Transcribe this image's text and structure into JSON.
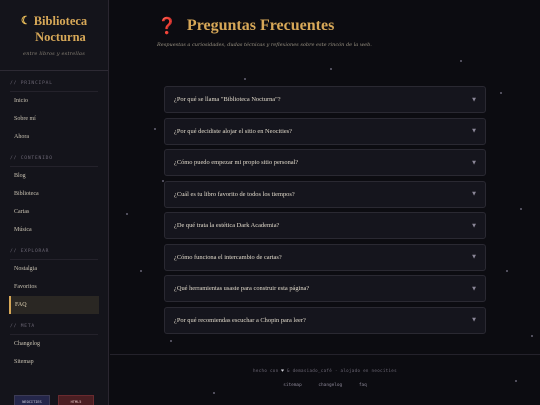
{
  "sidebar": {
    "brand_title_line1": "Biblioteca",
    "brand_title_line2": "Nocturna",
    "brand_icon": "crescent-moon-icon",
    "brand_subtitle": "entre libros y estrellas",
    "sections": [
      {
        "label": "// PRINCIPAL",
        "items": [
          "Inicio",
          "Sobre mí",
          "Ahora"
        ]
      },
      {
        "label": "// CONTENIDO",
        "items": [
          "Blog",
          "Biblioteca",
          "Cartas",
          "Música"
        ]
      },
      {
        "label": "// EXPLORAR",
        "items": [
          "Nostalgia",
          "Favoritos",
          "FAQ"
        ]
      },
      {
        "label": "// META",
        "items": [
          "Changelog",
          "Sitemap"
        ]
      }
    ],
    "active_item": "FAQ",
    "badges": [
      "NEOCITIES",
      "HTML5"
    ]
  },
  "main": {
    "title_icon": "question-mark-icon",
    "title": "Preguntas Frecuentes",
    "subtitle": "Respuestas a curiosidades, dudas técnicas y reflexiones sobre este rincón de la web.",
    "faq": [
      "¿Por qué se llama \"Biblioteca Nocturna\"?",
      "¿Por qué decidiste alojar el sitio en Neocities?",
      "¿Cómo puedo empezar mi propio sitio personal?",
      "¿Cuál es tu libro favorito de todos los tiempos?",
      "¿De qué trata la estética Dark Academia?",
      "¿Cómo funciona el intercambio de cartas?",
      "¿Qué herramientas usaste para construir esta página?",
      "¿Por qué recomiendas escuchar a Chopin para leer?"
    ],
    "faq_arrow": "▼"
  },
  "footer": {
    "made_with_prefix": "hecho con",
    "heart_icon": "♥",
    "made_with_suffix": "& demasiado_café · alojado en neocities",
    "links": [
      "sitemap",
      "changelog",
      "faq"
    ]
  },
  "colors": {
    "accent_gold": "#d7a858",
    "question_red": "#d03a2e",
    "background": "#0c0c11",
    "sidebar_bg": "#14141b"
  }
}
